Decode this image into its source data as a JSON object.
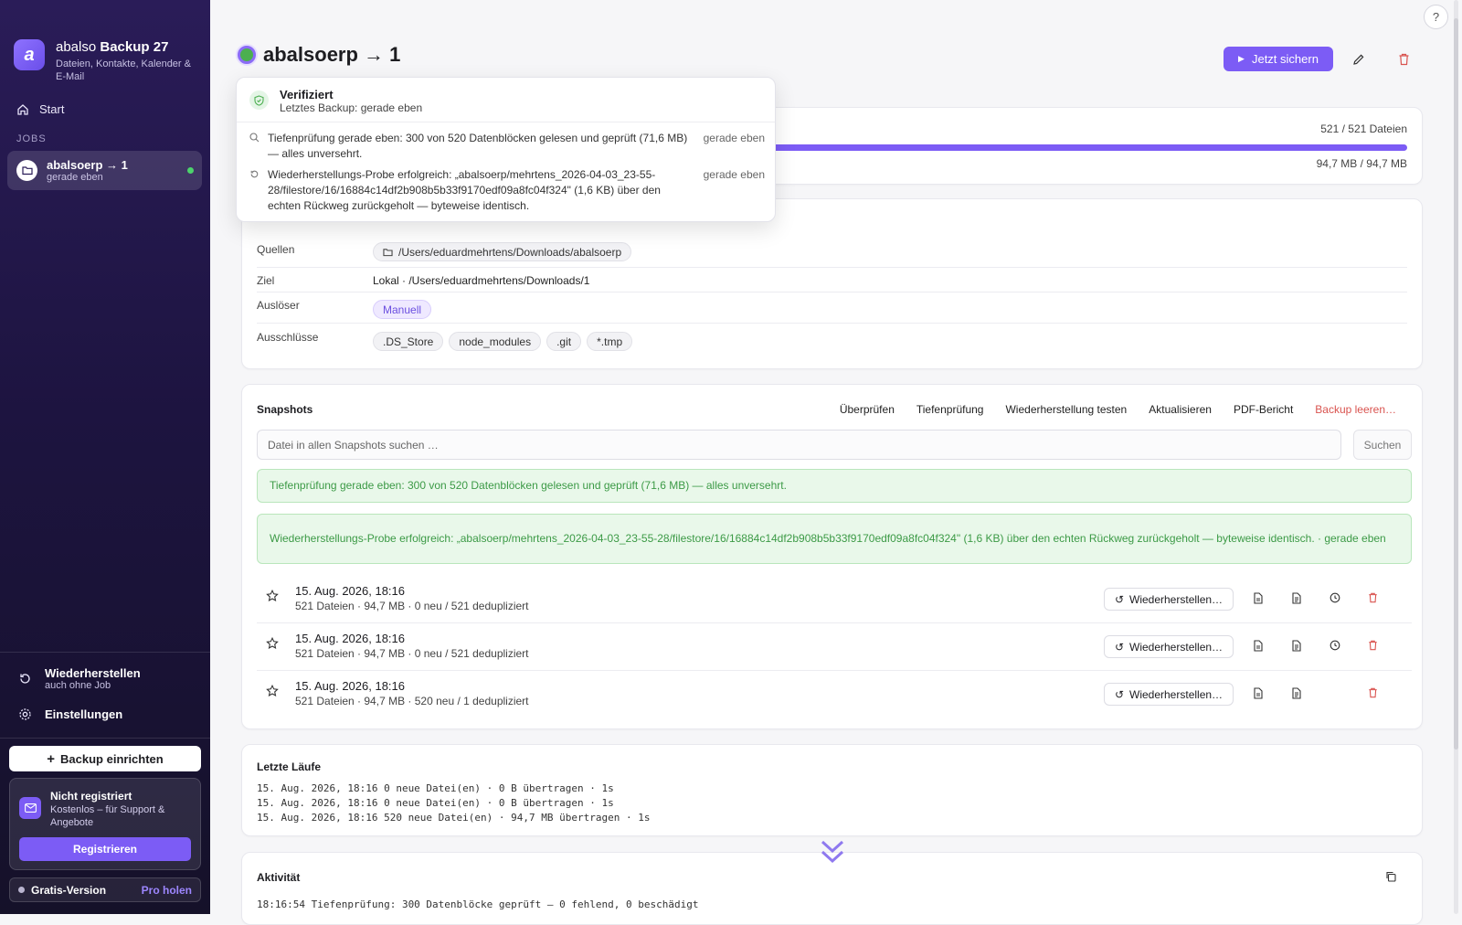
{
  "app": {
    "name_light": "abalso",
    "name_bold": "Backup 27",
    "subtitle": "Dateien, Kontakte, Kalender & E-Mail"
  },
  "sidebar": {
    "start_label": "Start",
    "jobs_heading": "JOBS",
    "job": {
      "name": "abalsoerp → 1",
      "sub": "gerade eben"
    },
    "restore": {
      "title": "Wiederherstellen",
      "sub": "auch ohne Job"
    },
    "settings_label": "Einstellungen",
    "setup_button": "Backup einrichten",
    "register": {
      "title": "Nicht registriert",
      "sub": "Kostenlos – für Support & Angebote",
      "button": "Registrieren"
    },
    "version": {
      "label": "Gratis-Version",
      "upgrade": "Pro holen"
    }
  },
  "header": {
    "title": "abalsoerp → 1",
    "run_button": "Jetzt sichern",
    "help_label": "?"
  },
  "progress": {
    "files": "521 / 521 Dateien",
    "size": "94,7 MB / 94,7 MB",
    "fraction": 1.0
  },
  "config": {
    "sources_label": "Quellen",
    "sources_value": "/Users/eduardmehrtens/Downloads/abalsoerp",
    "target_label": "Ziel",
    "target_value": "Lokal · /Users/eduardmehrtens/Downloads/1",
    "trigger_label": "Auslöser",
    "trigger_value": "Manuell",
    "excludes_label": "Ausschlüsse",
    "excludes": [
      ".DS_Store",
      "node_modules",
      ".git",
      "*.tmp"
    ]
  },
  "snapshots": {
    "title": "Snapshots",
    "actions": [
      "Überprüfen",
      "Tiefenprüfung",
      "Wiederherstellung testen",
      "Aktualisieren",
      "PDF-Bericht"
    ],
    "danger_action": "Backup leeren…",
    "search_placeholder": "Datei in allen Snapshots suchen …",
    "search_button": "Suchen",
    "notice_deep": "Tiefenprüfung gerade eben: 300 von 520 Datenblöcken gelesen und geprüft (71,6 MB) — alles unversehrt.",
    "notice_restore": "Wiederherstellungs-Probe erfolgreich: „abalsoerp/mehrtens_2026-04-03_23-55-28/filestore/16/16884c14df2b908b5b33f9170edf09a8fc04f324\" (1,6 KB) über den echten Rückweg zurückgeholt — byteweise identisch. · gerade eben",
    "restore_button": "Wiederherstellen…",
    "rows": [
      {
        "date": "15. Aug. 2026, 18:16",
        "meta": "521 Dateien · 94,7 MB · 0 neu / 521 dedupliziert"
      },
      {
        "date": "15. Aug. 2026, 18:16",
        "meta": "521 Dateien · 94,7 MB · 0 neu / 521 dedupliziert"
      },
      {
        "date": "15. Aug. 2026, 18:16",
        "meta": "521 Dateien · 94,7 MB · 520 neu / 1 dedupliziert"
      }
    ]
  },
  "runs": {
    "title": "Letzte Läufe",
    "lines": [
      "15. Aug. 2026, 18:16 0 neue Datei(en) · 0 B übertragen · 1s",
      "15. Aug. 2026, 18:16 0 neue Datei(en) · 0 B übertragen · 1s",
      "15. Aug. 2026, 18:16 520 neue Datei(en) · 94,7 MB übertragen · 1s"
    ]
  },
  "activity": {
    "title": "Aktivität",
    "line": "18:16:54 Tiefenprüfung: 300 Datenblöcke geprüft — 0 fehlend, 0 beschädigt"
  },
  "popover": {
    "title": "Verifiziert",
    "sub": "Letztes Backup: gerade eben",
    "items": [
      {
        "text": "Tiefenprüfung gerade eben: 300 von 520 Datenblöcken gelesen und geprüft (71,6 MB) — alles unversehrt.",
        "when": "gerade eben"
      },
      {
        "text": "Wiederherstellungs-Probe erfolgreich: „abalsoerp/mehrtens_2026-04-03_23-55-28/filestore/16/16884c14df2b908b5b33f9170edf09a8fc04f324\" (1,6 KB) über den echten Rückweg zurückgeholt — byteweise identisch.",
        "when": "gerade eben"
      }
    ]
  },
  "colors": {
    "accent": "#7c5cf5",
    "success": "#4caf50",
    "danger": "#d9534f"
  }
}
